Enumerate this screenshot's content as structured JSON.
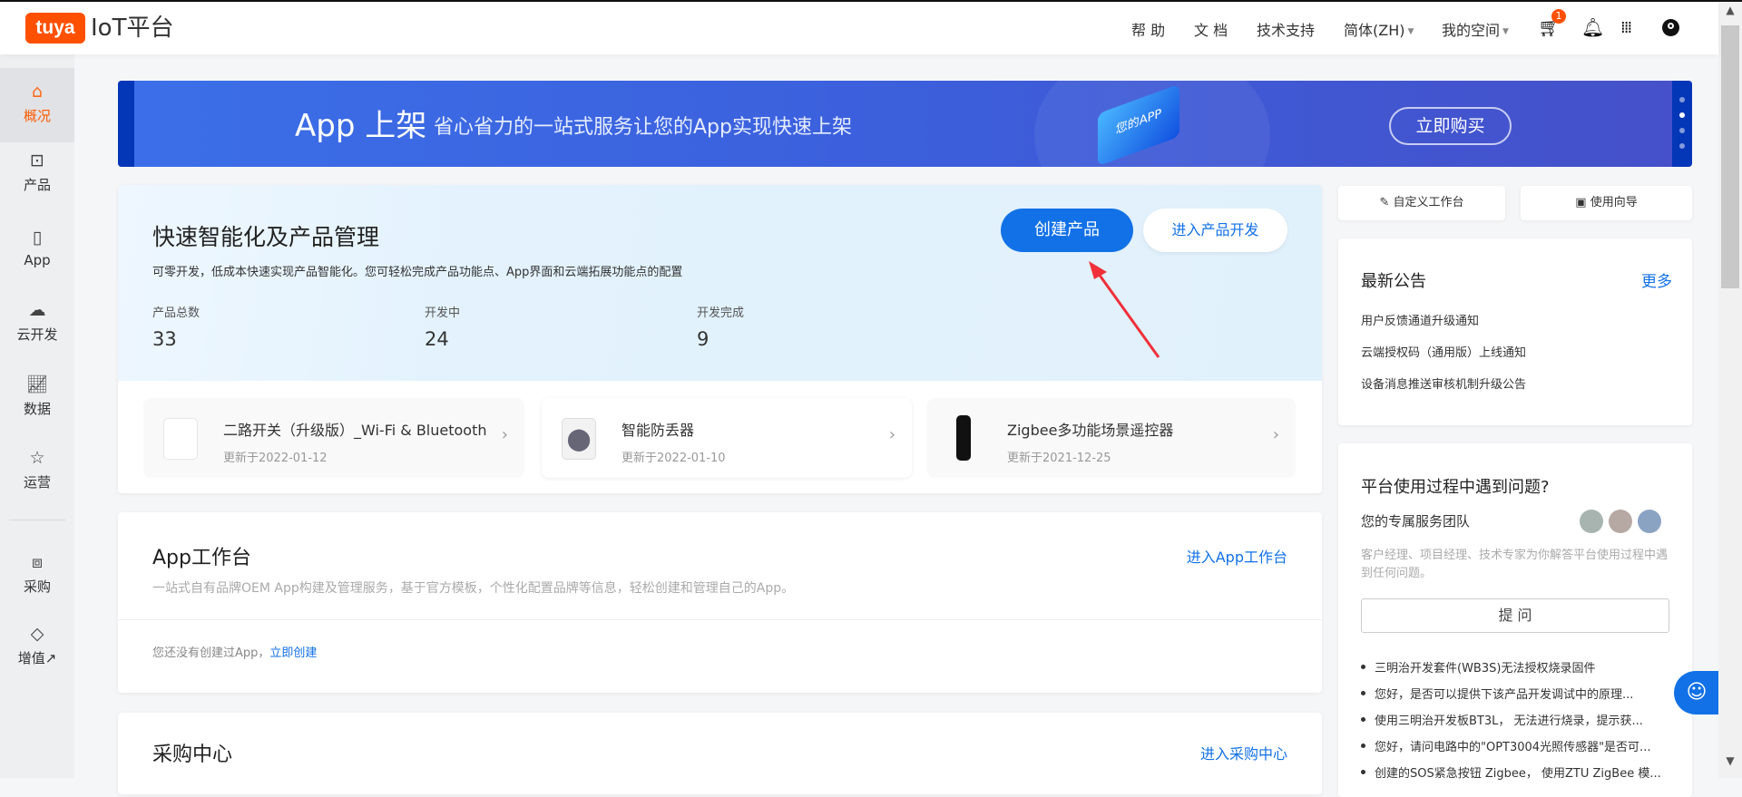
{
  "header": {
    "logo": "tuya",
    "platform": "IoT平台",
    "nav": [
      "帮 助",
      "文 档",
      "技术支持",
      "简体(ZH)",
      "我的空间"
    ],
    "cart_count": "1"
  },
  "sidebar": {
    "items": [
      {
        "label": "概况",
        "icon": "home-icon"
      },
      {
        "label": "产品",
        "icon": "terminal-icon"
      },
      {
        "label": "App",
        "icon": "phone-icon"
      },
      {
        "label": "云开发",
        "icon": "cloud-icon"
      },
      {
        "label": "数据",
        "icon": "chart-icon"
      },
      {
        "label": "运营",
        "icon": "bookmark-star-icon"
      },
      {
        "label": "采购",
        "icon": "box-icon"
      },
      {
        "label": "增值↗",
        "icon": "diamond-icon"
      }
    ]
  },
  "banner": {
    "title": "App 上架",
    "subtitle": "省心省力的一站式服务让您的App实现快速上架",
    "badge": "您的APP",
    "cta": "立即购买"
  },
  "product_mgmt": {
    "title": "快速智能化及产品管理",
    "desc": "可零开发，低成本快速实现产品智能化。您可轻松完成产品功能点、App界面和云端拓展功能点的配置",
    "create_btn": "创建产品",
    "dev_btn": "进入产品开发",
    "stats": [
      {
        "label": "产品总数",
        "value": "33"
      },
      {
        "label": "开发中",
        "value": "24"
      },
      {
        "label": "开发完成",
        "value": "9"
      }
    ],
    "products": [
      {
        "name": "二路开关（升级版）_Wi-Fi & Bluetooth",
        "date": "更新于2022-01-12"
      },
      {
        "name": "智能防丢器",
        "date": "更新于2022-01-10"
      },
      {
        "name": "Zigbee多功能场景遥控器",
        "date": "更新于2021-12-25"
      }
    ]
  },
  "app_workbench": {
    "title": "App工作台",
    "link": "进入App工作台",
    "desc": "一站式自有品牌OEM App构建及管理服务，基于官方模板，个性化配置品牌等信息，轻松创建和管理自己的App。",
    "empty": "您还没有创建过App，",
    "create_link": "立即创建"
  },
  "purchase": {
    "title": "采购中心",
    "link": "进入采购中心"
  },
  "right": {
    "customize": "自定义工作台",
    "guide": "使用向导",
    "notices": {
      "title": "最新公告",
      "more": "更多",
      "items": [
        "用户反馈通道升级通知",
        "云端授权码（通用版）上线通知",
        "设备消息推送审核机制升级公告"
      ]
    },
    "help": {
      "title": "平台使用过程中遇到问题?",
      "team": "您的专属服务团队",
      "desc": "客户经理、项目经理、技术专家为你解答平台使用过程中遇到任何问题。",
      "ask": "提 问",
      "questions": [
        "三明治开发套件(WB3S)无法授权烧录固件",
        "您好，是否可以提供下该产品开发调试中的原理...",
        "使用三明治开发板BT3L， 无法进行烧录，提示获...",
        "您好，请问电路中的\"OPT3004光照传感器\"是否可...",
        "创建的SOS紧急按钮 Zigbee， 使用ZTU ZigBee 模..."
      ]
    }
  },
  "colors": {
    "brand": "#ff5000",
    "primary": "#1271e6"
  }
}
